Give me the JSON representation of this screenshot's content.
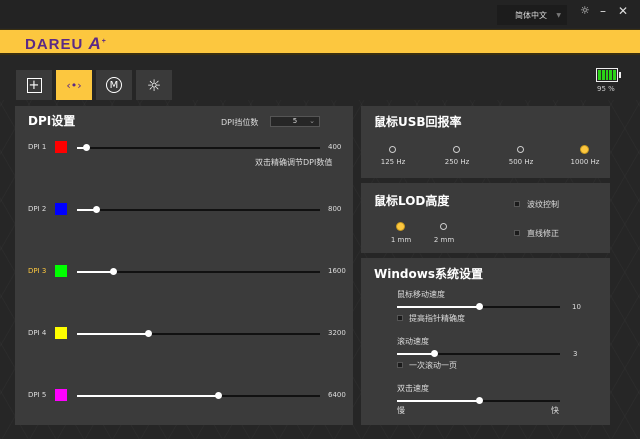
{
  "window": {
    "language": "简体中文",
    "brand": "DAREU",
    "brand_mark": "A"
  },
  "toolbar": {
    "tabs": [
      "buttons",
      "dpi",
      "macro",
      "lighting"
    ],
    "active": "dpi"
  },
  "battery": {
    "percent_label": "95 %",
    "level": 0.95
  },
  "dpi": {
    "title": "DPI设置",
    "count_label": "DPI挡位数",
    "count_value": "5",
    "hint": "双击精确调节DPI数值",
    "levels": [
      {
        "label": "DPI 1",
        "value": "400",
        "color": "#ff0000",
        "fraction": 0.037,
        "active": false
      },
      {
        "label": "DPI 2",
        "value": "800",
        "color": "#0000ff",
        "fraction": 0.078,
        "active": false
      },
      {
        "label": "DPI 3",
        "value": "1600",
        "color": "#00ff00",
        "fraction": 0.148,
        "active": true
      },
      {
        "label": "DPI 4",
        "value": "3200",
        "color": "#ffff00",
        "fraction": 0.292,
        "active": false
      },
      {
        "label": "DPI 5",
        "value": "6400",
        "color": "#ff00ff",
        "fraction": 0.58,
        "active": false
      }
    ]
  },
  "usb": {
    "title": "鼠标USB回报率",
    "options": [
      "125 Hz",
      "250 Hz",
      "500 Hz",
      "1000 Hz"
    ],
    "selected": 3
  },
  "lod": {
    "title": "鼠标LOD高度",
    "options": [
      "1 mm",
      "2 mm"
    ],
    "selected": 0,
    "ripple_label": "波纹控制",
    "angle_label": "直线修正"
  },
  "windows": {
    "title": "Windows系统设置",
    "pointer_speed": {
      "label": "鼠标移动速度",
      "value": "10",
      "fraction": 0.5
    },
    "precision_label": "提高指针精确度",
    "scroll_speed": {
      "label": "滚动速度",
      "value": "3",
      "fraction": 0.23
    },
    "scroll_page_label": "一次滚动一页",
    "double_click": {
      "label": "双击速度",
      "fraction": 0.5,
      "slow": "慢",
      "fast": "快"
    }
  },
  "colors": {
    "accent": "#fcc73f",
    "brand": "#5b2a86"
  }
}
